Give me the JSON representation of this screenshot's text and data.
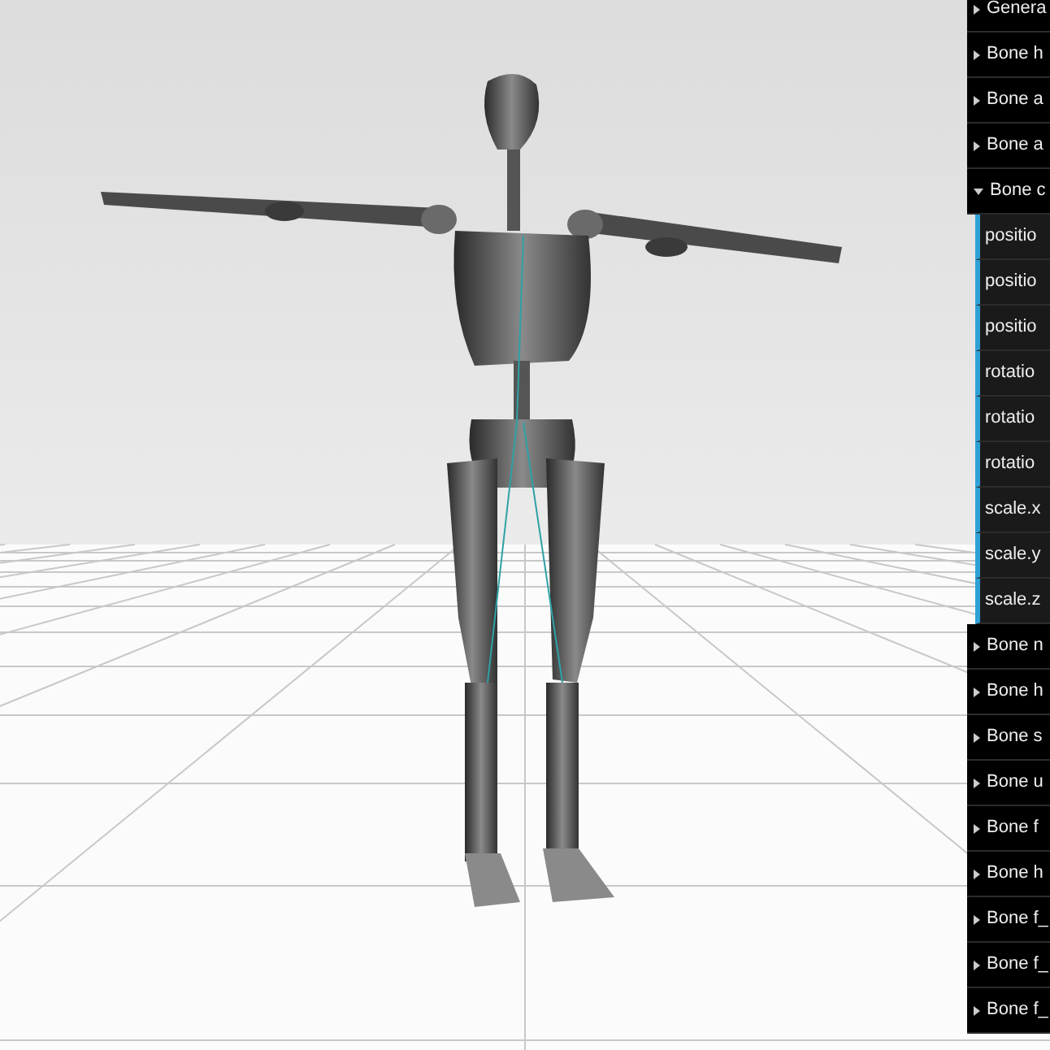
{
  "panel": {
    "folders": [
      {
        "label": "Genera",
        "expanded": false
      },
      {
        "label": "Bone h",
        "expanded": false
      },
      {
        "label": "Bone a",
        "expanded": false
      },
      {
        "label": "Bone a",
        "expanded": false
      },
      {
        "label": "Bone c",
        "expanded": true,
        "controllers": [
          {
            "label": "positio"
          },
          {
            "label": "positio"
          },
          {
            "label": "positio"
          },
          {
            "label": "rotatio"
          },
          {
            "label": "rotatio"
          },
          {
            "label": "rotatio"
          },
          {
            "label": "scale.x"
          },
          {
            "label": "scale.y"
          },
          {
            "label": "scale.z"
          }
        ]
      },
      {
        "label": "Bone n",
        "expanded": false
      },
      {
        "label": "Bone h",
        "expanded": false
      },
      {
        "label": "Bone s",
        "expanded": false
      },
      {
        "label": "Bone u",
        "expanded": false
      },
      {
        "label": "Bone f",
        "expanded": false
      },
      {
        "label": "Bone h",
        "expanded": false
      },
      {
        "label": "Bone f_",
        "expanded": false
      },
      {
        "label": "Bone f_",
        "expanded": false
      },
      {
        "label": "Bone f_",
        "expanded": false
      }
    ]
  }
}
